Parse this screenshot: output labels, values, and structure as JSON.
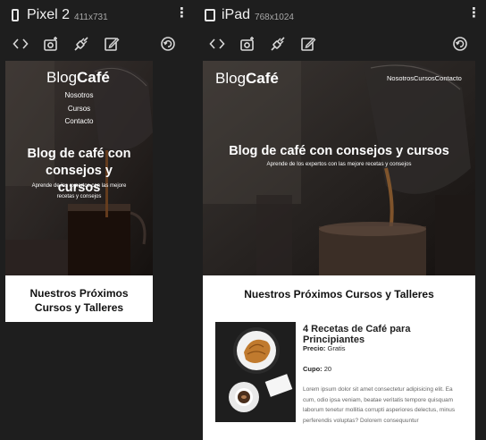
{
  "devices": [
    {
      "name": "Pixel 2",
      "size": "411x731",
      "page": {
        "logo_light": "Blog",
        "logo_bold": "Café",
        "nav": [
          "Nosotros",
          "Cursos",
          "Contacto"
        ],
        "hero_title": "Blog de café con consejos y cursos",
        "hero_subtitle": "Aprende de los expertos con las mejore recetas y consejos",
        "section_title": "Nuestros Próximos Cursos y Talleres"
      }
    },
    {
      "name": "iPad",
      "size": "768x1024",
      "page": {
        "logo_light": "Blog",
        "logo_bold": "Café",
        "nav_inline": "NosotrosCursosContacto",
        "hero_title": "Blog de café con consejos y cursos",
        "hero_subtitle": "Aprende de los expertos con las mejore recetas y consejos",
        "section_title": "Nuestros Próximos Cursos y Talleres",
        "course": {
          "title": "4 Recetas de Café para Principiantes",
          "price_label": "Precio:",
          "price_value": "Gratis",
          "quota_label": "Cupo:",
          "quota_value": "20",
          "description": "Lorem ipsum dolor sit amet consectetur adipisicing elit. Ea cum, odio ipsa veniam, beatae veritatis tempore quisquam laborum tenetur mollitia corrupti asperiores delectus, minus perferendis voluptas? Dolorem consequuntur"
        }
      }
    }
  ],
  "toolbar_icons": [
    "code-icon",
    "screenshot-icon",
    "network-icon",
    "edit-icon",
    "rotate-icon"
  ],
  "colors": {
    "background": "#1e1e1e",
    "hero_overlay": "#000000",
    "text_light": "#e6e6e6"
  }
}
